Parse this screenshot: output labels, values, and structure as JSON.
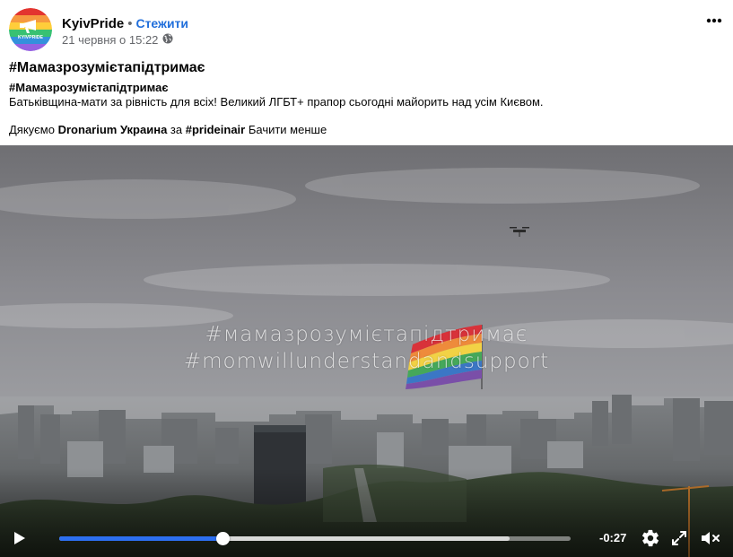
{
  "header": {
    "page_name": "KyivPride",
    "separator": "•",
    "follow_label": "Стежити",
    "timestamp": "21 червня о 15:22",
    "audience_icon": "globe-icon",
    "more_icon": "more-horizontal-icon"
  },
  "avatar": {
    "logo_text": "KYIVPRIDE",
    "colors": [
      "#e3342f",
      "#f6993f",
      "#ffcd3a",
      "#38c172",
      "#3490dc",
      "#9561e2"
    ]
  },
  "post": {
    "title": "#Мамазрозумієтапідтримає",
    "hashtag_line": "#Мамазрозумієтапідтримає",
    "body_line": "Батьківщина-мати за рівність для всіх! Великий ЛГБТ+ прапор сьогодні майорить над усім Києвом.",
    "thanks_prefix": "Дякуємо",
    "thanks_name": "Dronarium Украина",
    "thanks_mid": "за",
    "thanks_tag": "#prideinair",
    "see_less": "Бачити менше"
  },
  "video": {
    "overlay_line1": "#мамазрозумієтапідтримає",
    "overlay_line2": "#momwillunderstandandsupport",
    "remaining_time": "-0:27",
    "progress": 0.32,
    "buffered": 0.88,
    "play_icon": "play-icon",
    "settings_icon": "gear-icon",
    "fullscreen_icon": "fullscreen-icon",
    "mute_icon": "speaker-muted-icon"
  }
}
